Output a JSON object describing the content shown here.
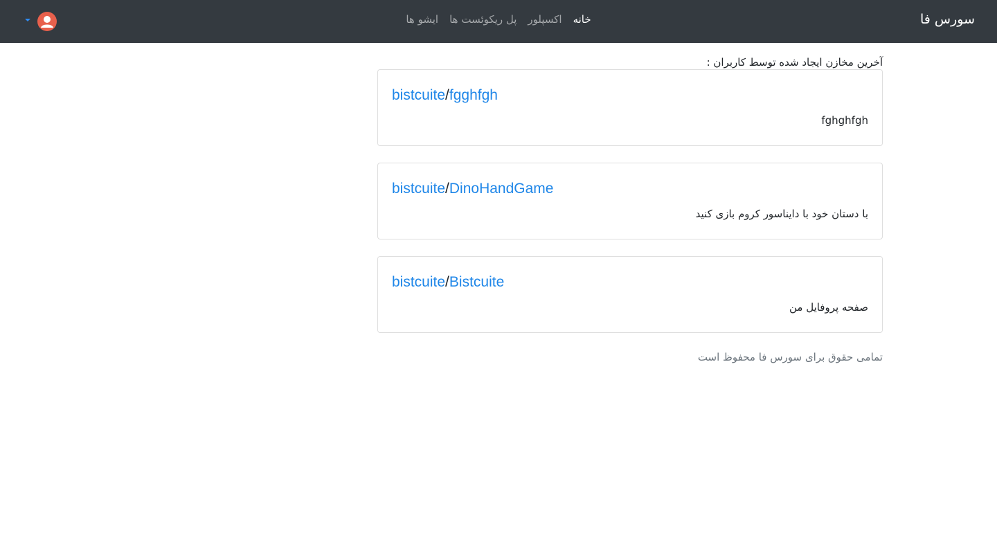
{
  "navbar": {
    "brand": "سورس فا",
    "links": [
      {
        "label": "خانه",
        "active": true
      },
      {
        "label": "اکسپلور",
        "active": false
      },
      {
        "label": "پل ریکوئست ها",
        "active": false
      },
      {
        "label": "ایشو ها",
        "active": false
      }
    ],
    "avatar_icon": "user-icon",
    "dropdown_icon": "caret-down-icon"
  },
  "main": {
    "section_title": "آخرین مخازن ایجاد شده توسط کاربران :",
    "repos": [
      {
        "owner": "bistcuite",
        "separator": "/",
        "name": "fgghfgh",
        "description": "fghghfgh"
      },
      {
        "owner": "bistcuite",
        "separator": "/",
        "name": "DinoHandGame",
        "description": "با دستان خود با دایناسور کروم بازی کنید"
      },
      {
        "owner": "bistcuite",
        "separator": "/",
        "name": "Bistcuite",
        "description": "صفحه پروفایل من"
      }
    ],
    "footer": "تمامی حقوق برای سورس فا محفوظ است"
  },
  "colors": {
    "navbar_bg": "#343a40",
    "link": "#1e86e8",
    "avatar_bg": "#e8604c",
    "muted": "#6c757d"
  }
}
